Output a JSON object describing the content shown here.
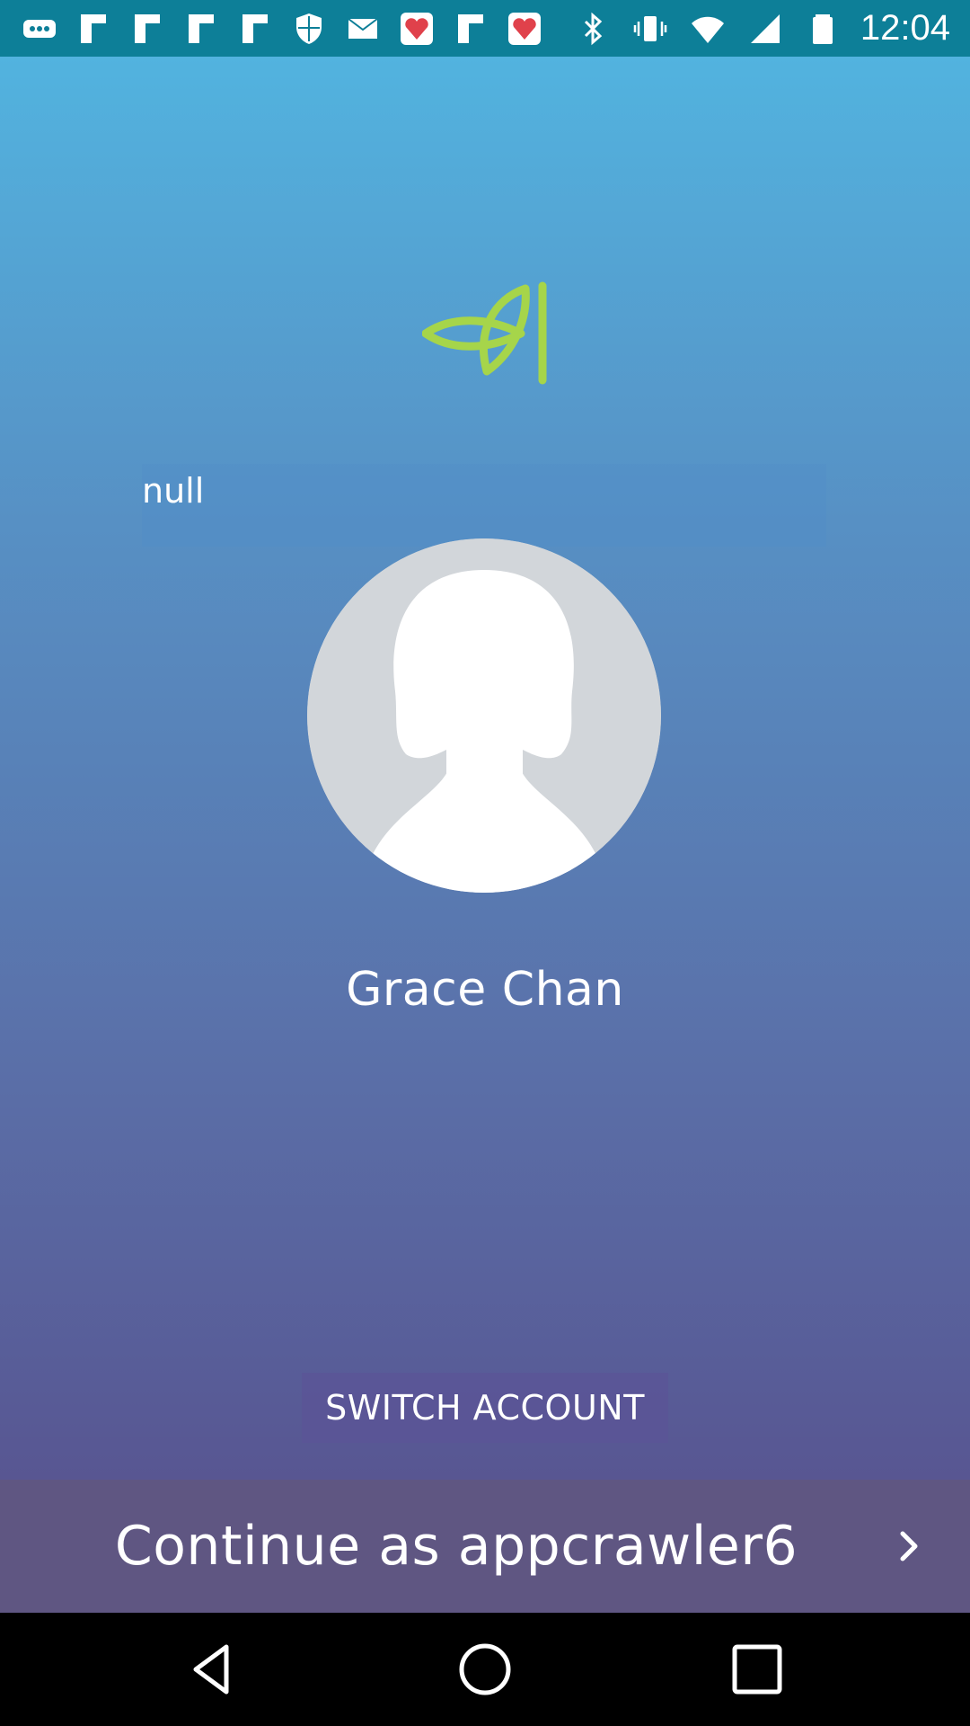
{
  "status_bar": {
    "time": "12:04",
    "left_icons": [
      "more-dots-icon",
      "flipboard-icon",
      "flipboard-icon",
      "flipboard-icon",
      "flipboard-icon",
      "shield-icon",
      "mail-icon",
      "fastmeet-icon",
      "flipboard-icon",
      "fastmeet-icon"
    ],
    "right_icons": [
      "bluetooth-icon",
      "vibrate-icon",
      "wifi-icon",
      "signal-icon",
      "battery-icon"
    ]
  },
  "main": {
    "name_field": {
      "value": "null"
    },
    "user_name": "Grace Chan",
    "switch_account_label": "SWITCH ACCOUNT",
    "continue_label": "Continue as appcrawler6"
  },
  "colors": {
    "status_bar": "#0d7f98",
    "gradient_top": "#52b3df",
    "gradient_bottom": "#574e8b",
    "logo": "#a6d54a",
    "avatar_bg": "#d2d6da",
    "continue_bar": "#5f5682"
  }
}
